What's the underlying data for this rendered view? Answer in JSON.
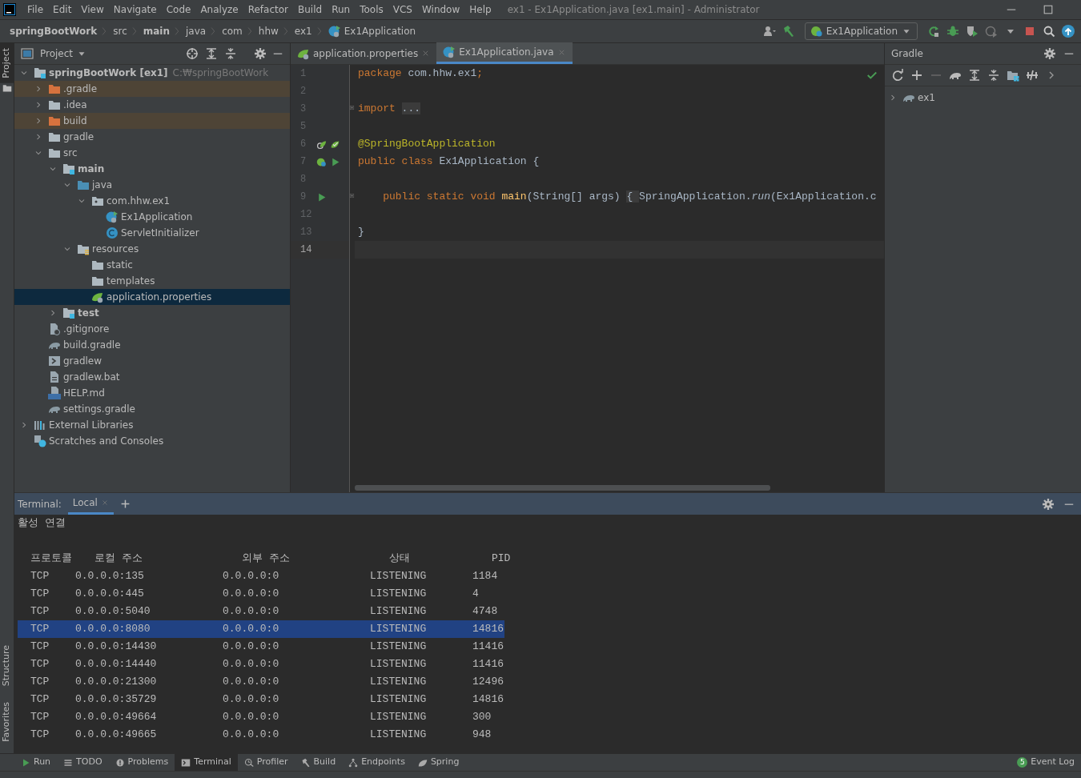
{
  "window": {
    "title": "ex1 - Ex1Application.java [ex1.main] - Administrator"
  },
  "menu": [
    "File",
    "Edit",
    "View",
    "Navigate",
    "Code",
    "Analyze",
    "Refactor",
    "Build",
    "Run",
    "Tools",
    "VCS",
    "Window",
    "Help"
  ],
  "breadcrumbs": [
    {
      "label": "springBootWork",
      "kind": "project"
    },
    {
      "label": "src",
      "kind": "dir"
    },
    {
      "label": "main",
      "kind": "module"
    },
    {
      "label": "java",
      "kind": "dir"
    },
    {
      "label": "com",
      "kind": "dir"
    },
    {
      "label": "hhw",
      "kind": "dir"
    },
    {
      "label": "ex1",
      "kind": "dir"
    },
    {
      "label": "Ex1Application",
      "kind": "class"
    }
  ],
  "run_config": "Ex1Application",
  "side_tabs_top": [
    {
      "label": "Project",
      "selected": true
    }
  ],
  "side_tabs_bottom": [
    {
      "label": "Structure",
      "selected": false
    },
    {
      "label": "Favorites",
      "selected": false
    }
  ],
  "project": {
    "title": "Project",
    "tree": [
      {
        "label": "springBootWork [ex1]",
        "hint": "C:₩springBootWork",
        "kind": "module",
        "expanded": true,
        "selected": false,
        "children": [
          {
            "label": ".gradle",
            "kind": "excluded",
            "expanded": false,
            "selected": false
          },
          {
            "label": ".idea",
            "kind": "folder",
            "expanded": false,
            "selected": false
          },
          {
            "label": "build",
            "kind": "excluded",
            "expanded": false,
            "selected": false
          },
          {
            "label": "gradle",
            "kind": "folder",
            "expanded": false,
            "selected": false
          },
          {
            "label": "src",
            "kind": "folder",
            "expanded": true,
            "selected": false,
            "children": [
              {
                "label": "main",
                "kind": "root",
                "expanded": true,
                "selected": false,
                "children": [
                  {
                    "label": "java",
                    "kind": "source",
                    "expanded": true,
                    "selected": false,
                    "children": [
                      {
                        "label": "com.hhw.ex1",
                        "kind": "package",
                        "expanded": true,
                        "selected": false,
                        "children": [
                          {
                            "label": "Ex1Application",
                            "kind": "app",
                            "selected": false
                          },
                          {
                            "label": "ServletInitializer",
                            "kind": "class",
                            "selected": false
                          }
                        ]
                      }
                    ]
                  },
                  {
                    "label": "resources",
                    "kind": "resources",
                    "expanded": true,
                    "selected": false,
                    "children": [
                      {
                        "label": "static",
                        "kind": "folder",
                        "selected": false
                      },
                      {
                        "label": "templates",
                        "kind": "folder",
                        "selected": false
                      },
                      {
                        "label": "application.properties",
                        "kind": "properties",
                        "selected": true
                      }
                    ]
                  }
                ]
              },
              {
                "label": "test",
                "kind": "root",
                "expanded": false,
                "selected": false
              }
            ]
          },
          {
            "label": ".gitignore",
            "kind": "ignore",
            "selected": false
          },
          {
            "label": "build.gradle",
            "kind": "gradle",
            "selected": false
          },
          {
            "label": "gradlew",
            "kind": "script",
            "selected": false
          },
          {
            "label": "gradlew.bat",
            "kind": "text",
            "selected": false
          },
          {
            "label": "HELP.md",
            "kind": "markdown",
            "selected": false
          },
          {
            "label": "settings.gradle",
            "kind": "gradle",
            "selected": false
          }
        ]
      },
      {
        "label": "External Libraries",
        "kind": "libraries",
        "expanded": false,
        "selected": false
      },
      {
        "label": "Scratches and Consoles",
        "kind": "scratches",
        "selected": false
      }
    ]
  },
  "editor": {
    "tabs": [
      {
        "label": "application.properties",
        "kind": "properties",
        "selected": false
      },
      {
        "label": "Ex1Application.java",
        "kind": "app",
        "selected": true
      }
    ],
    "lines": [
      {
        "number": "1",
        "tokens": [
          {
            "kind": "keyword",
            "text": "package"
          },
          {
            "kind": "plain",
            "text": " com.hhw.ex1"
          },
          {
            "kind": "keyword",
            "text": ";"
          }
        ]
      },
      {
        "number": "2"
      },
      {
        "number": "3",
        "folded": true,
        "tokens": [
          {
            "kind": "keyword",
            "text": "import "
          },
          {
            "kind": "folded",
            "text": "..."
          }
        ]
      },
      {
        "number": "5"
      },
      {
        "number": "6",
        "markers": [
          {
            "kind": "bean"
          },
          {
            "kind": "beancheck"
          }
        ],
        "tokens": [
          {
            "kind": "annotation",
            "text": "@SpringBootApplication"
          }
        ]
      },
      {
        "number": "7",
        "markers": [
          {
            "kind": "boot"
          },
          {
            "kind": "play"
          }
        ],
        "tokens": [
          {
            "kind": "keyword",
            "text": "public class"
          },
          {
            "kind": "plain",
            "text": " Ex1Application {"
          }
        ]
      },
      {
        "number": "8"
      },
      {
        "number": "9",
        "markers": [
          {
            "kind": "play"
          }
        ],
        "folded": true,
        "tokens": [
          {
            "kind": "keyword",
            "text": "    public static void "
          },
          {
            "kind": "method",
            "text": "main"
          },
          {
            "kind": "plain",
            "text": "(String[] args) "
          },
          {
            "kind": "folded",
            "text": "{ "
          },
          {
            "kind": "plain",
            "text": "SpringApplication."
          },
          {
            "kind": "italic",
            "text": "run"
          },
          {
            "kind": "plain",
            "text": "(Ex1Application.c"
          }
        ]
      },
      {
        "number": "12"
      },
      {
        "number": "13",
        "tokens": [
          {
            "kind": "plain",
            "text": "}"
          }
        ]
      },
      {
        "number": "14",
        "current": true
      }
    ]
  },
  "gradle": {
    "title": "Gradle",
    "tree": [
      {
        "label": "ex1",
        "expanded": false
      }
    ]
  },
  "terminal": {
    "title": "Terminal:",
    "tabs": [
      {
        "label": "Local",
        "selected": true
      }
    ],
    "heading": "활성 연결",
    "columns": [
      "프로토콜",
      "로컬 주소",
      "외부 주소",
      "상태",
      "PID"
    ],
    "rows": [
      {
        "cells": [
          "TCP",
          "0.0.0.0:135",
          "0.0.0.0:0",
          "LISTENING",
          "1184"
        ],
        "selected": false
      },
      {
        "cells": [
          "TCP",
          "0.0.0.0:445",
          "0.0.0.0:0",
          "LISTENING",
          "4"
        ],
        "selected": false
      },
      {
        "cells": [
          "TCP",
          "0.0.0.0:5040",
          "0.0.0.0:0",
          "LISTENING",
          "4748"
        ],
        "selected": false
      },
      {
        "cells": [
          "TCP",
          "0.0.0.0:8080",
          "0.0.0.0:0",
          "LISTENING",
          "14816"
        ],
        "selected": true
      },
      {
        "cells": [
          "TCP",
          "0.0.0.0:14430",
          "0.0.0.0:0",
          "LISTENING",
          "11416"
        ],
        "selected": false
      },
      {
        "cells": [
          "TCP",
          "0.0.0.0:14440",
          "0.0.0.0:0",
          "LISTENING",
          "11416"
        ],
        "selected": false
      },
      {
        "cells": [
          "TCP",
          "0.0.0.0:21300",
          "0.0.0.0:0",
          "LISTENING",
          "12496"
        ],
        "selected": false
      },
      {
        "cells": [
          "TCP",
          "0.0.0.0:35729",
          "0.0.0.0:0",
          "LISTENING",
          "14816"
        ],
        "selected": false
      },
      {
        "cells": [
          "TCP",
          "0.0.0.0:49664",
          "0.0.0.0:0",
          "LISTENING",
          "300"
        ],
        "selected": false
      },
      {
        "cells": [
          "TCP",
          "0.0.0.0:49665",
          "0.0.0.0:0",
          "LISTENING",
          "948"
        ],
        "selected": false
      }
    ]
  },
  "tool_windows": [
    {
      "label": "Run",
      "kind": "play",
      "selected": false
    },
    {
      "label": "TODO",
      "kind": "list",
      "selected": false
    },
    {
      "label": "Problems",
      "kind": "problems",
      "selected": false
    },
    {
      "label": "Terminal",
      "kind": "terminal",
      "selected": true
    },
    {
      "label": "Profiler",
      "kind": "profiler",
      "selected": false
    },
    {
      "label": "Build",
      "kind": "hammer",
      "selected": false
    },
    {
      "label": "Endpoints",
      "kind": "endpoints",
      "selected": false
    },
    {
      "label": "Spring",
      "kind": "leaf",
      "selected": false
    }
  ],
  "event_log": {
    "label": "Event Log",
    "count": "5"
  }
}
